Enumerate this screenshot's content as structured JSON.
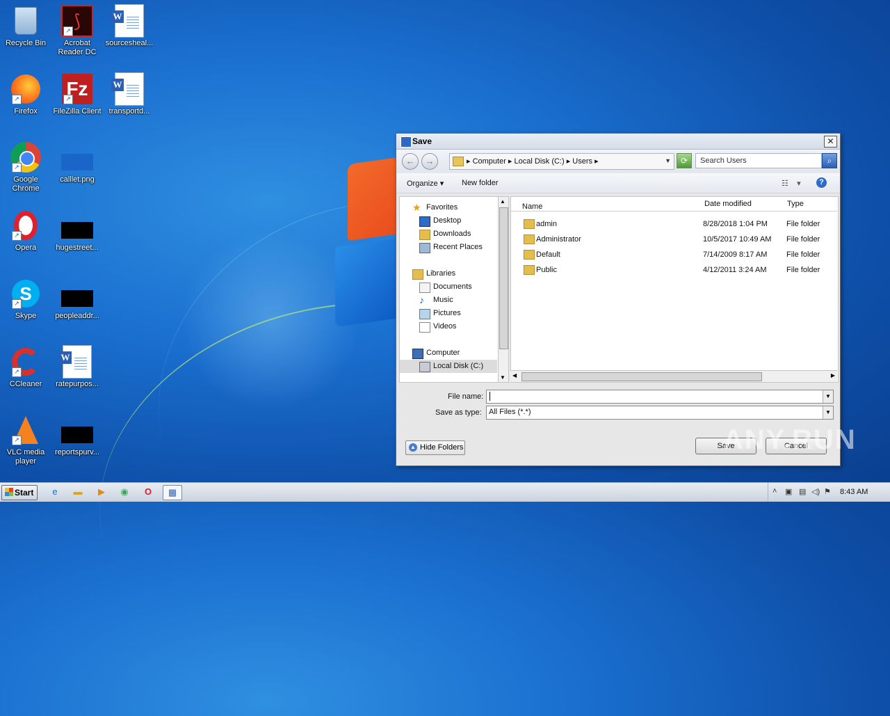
{
  "desktop": {
    "icons": [
      {
        "label": "Recycle Bin"
      },
      {
        "label": "Acrobat Reader DC"
      },
      {
        "label": "sourceshеal..."
      },
      {
        "label": "Firefox"
      },
      {
        "label": "FileZilla Client"
      },
      {
        "label": "transportd..."
      },
      {
        "label": "Google Chrome"
      },
      {
        "label": "calllet.png"
      },
      {
        "label": "Opera"
      },
      {
        "label": "hugestreet..."
      },
      {
        "label": "Skype"
      },
      {
        "label": "peopleaddr..."
      },
      {
        "label": "CCleaner"
      },
      {
        "label": "ratepurpos..."
      },
      {
        "label": "VLC media player"
      },
      {
        "label": "reportspurv..."
      }
    ],
    "colors": {
      "background": "#1a6fcf",
      "accent_orange": "#f26b2a"
    }
  },
  "dialog": {
    "title": "Save",
    "address": {
      "crumbs": [
        "Computer",
        "Local Disk (C:)",
        "Users"
      ]
    },
    "search_placeholder": "Search Users",
    "toolbar": {
      "organize": "Organize",
      "new_folder": "New folder"
    },
    "nav": {
      "favorites": "Favorites",
      "desktop": "Desktop",
      "downloads": "Downloads",
      "recent": "Recent Places",
      "libraries": "Libraries",
      "documents": "Documents",
      "music": "Music",
      "pictures": "Pictures",
      "videos": "Videos",
      "computer": "Computer",
      "local_disk": "Local Disk (C:)"
    },
    "columns": {
      "name": "Name",
      "date": "Date modified",
      "type": "Type"
    },
    "files": [
      {
        "name": "admin",
        "date": "8/28/2018 1:04 PM",
        "type": "File folder"
      },
      {
        "name": "Administrator",
        "date": "10/5/2017 10:49 AM",
        "type": "File folder"
      },
      {
        "name": "Default",
        "date": "7/14/2009 8:17 AM",
        "type": "File folder"
      },
      {
        "name": "Public",
        "date": "4/12/2011 3:24 AM",
        "type": "File folder"
      }
    ],
    "file_name_label": "File name:",
    "file_name_value": "",
    "save_type_label": "Save as type:",
    "save_type_value": "All Files (*.*)",
    "hide_folders": "Hide Folders",
    "save_button": "Save",
    "cancel_button": "Cancel"
  },
  "taskbar": {
    "start": "Start",
    "clock": "8:43 AM"
  },
  "watermark": "ANY.RUN"
}
